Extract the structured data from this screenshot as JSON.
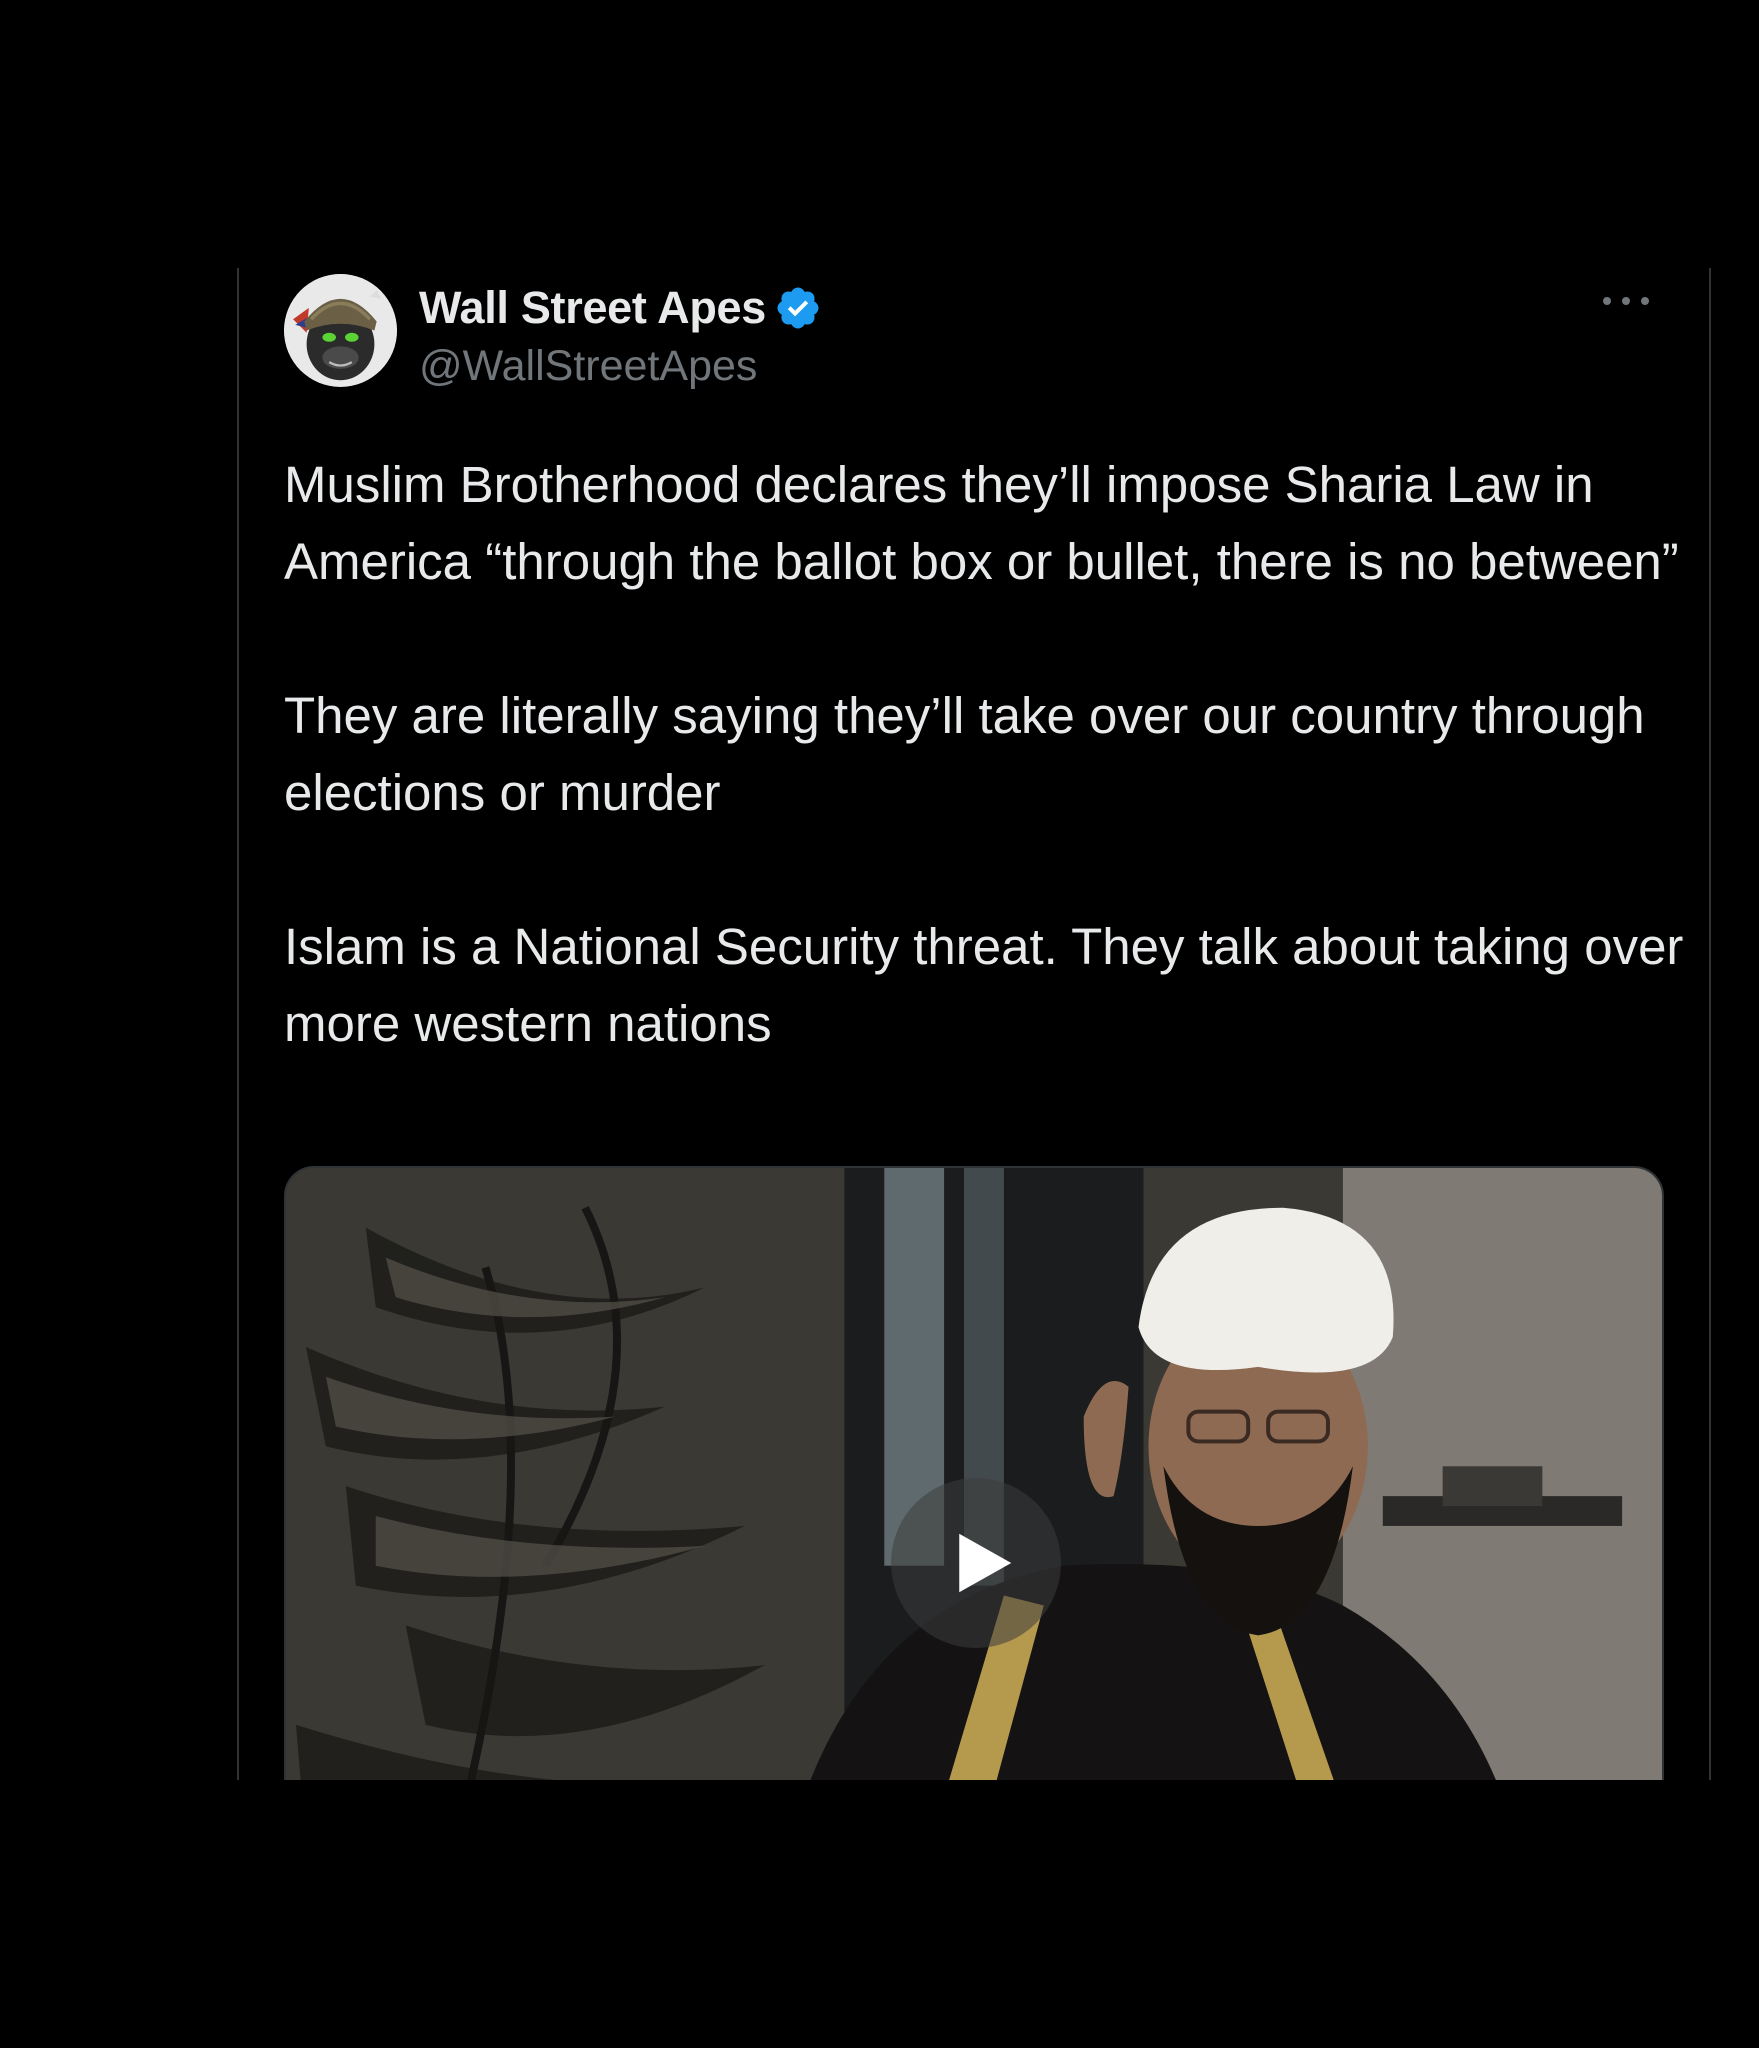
{
  "tweet": {
    "author": {
      "display_name": "Wall Street Apes",
      "handle": "@WallStreetApes",
      "verified": true,
      "avatar_icon": "helmeted-ape-avatar"
    },
    "more_icon": "ellipsis-icon",
    "paragraphs": [
      "Muslim Brotherhood declares they’ll impose Sharia Law in America “through the ballot box or bullet, there is no between”",
      "They are literally saying they’ll take over our country through elections or murder",
      "Islam is a National Security threat. They talk about taking over more western nations"
    ],
    "media": {
      "type": "video",
      "play_icon": "play-icon"
    }
  },
  "colors": {
    "background": "#000000",
    "text_primary": "#e7e9ea",
    "text_secondary": "#71767b",
    "border": "#2f3336",
    "verified_blue": "#1d9bf0"
  }
}
